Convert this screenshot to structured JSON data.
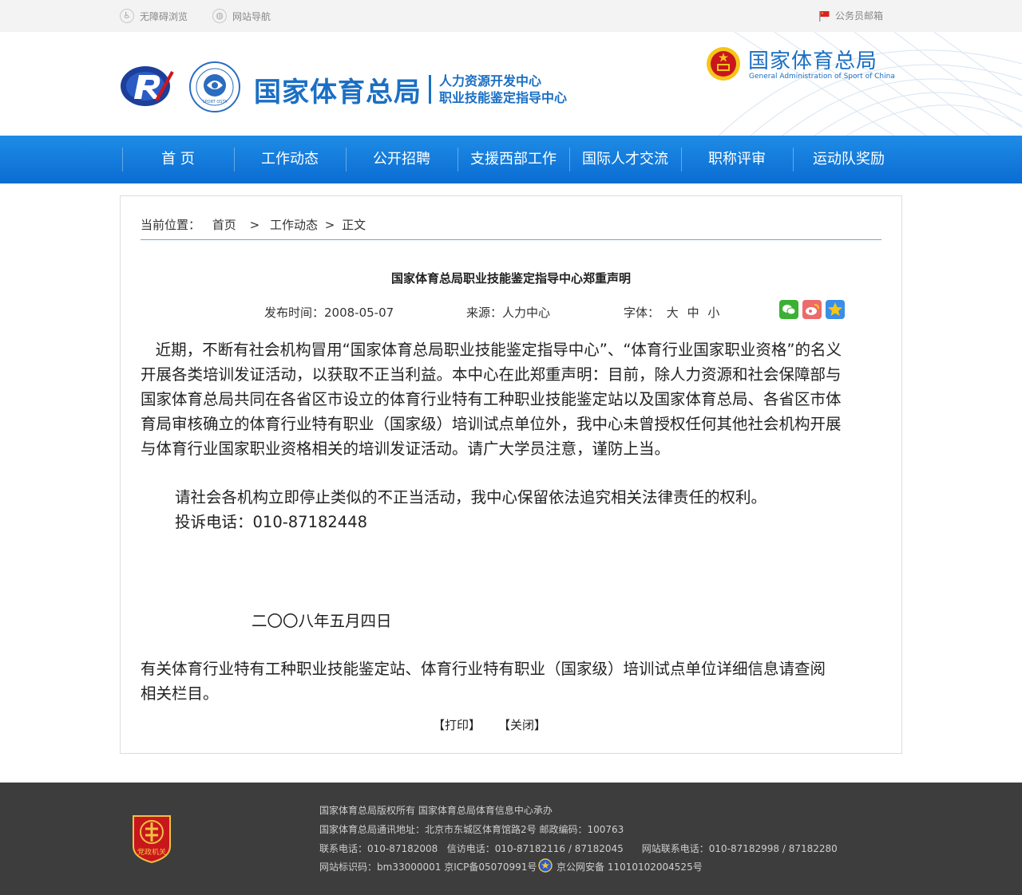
{
  "topbar": {
    "accessible": "无障碍浏览",
    "sitemap": "网站导航",
    "mail": "公务员邮箱"
  },
  "header": {
    "org_name": "国家体育总局",
    "dept_line1": "人力资源开发中心",
    "dept_line2": "职业技能鉴定指导中心",
    "right_name": "国家体育总局",
    "right_english": "General Administration of Sport of China",
    "seal_text": "SPORT OSTA"
  },
  "nav": [
    "首 页",
    "工作动态",
    "公开招聘",
    "支援西部工作",
    "国际人才交流",
    "职称评审",
    "运动队奖励"
  ],
  "breadcrumb": {
    "label": "当前位置：",
    "home": "首页",
    "sep1": ">",
    "section": "工作动态",
    "sep2": ">",
    "current": "正文"
  },
  "article": {
    "title": "国家体育总局职业技能鉴定指导中心郑重声明",
    "publish": "发布时间：2008-05-07",
    "source": "来源：人力中心",
    "font_label": "字体：",
    "font_sizes": [
      "大",
      "中",
      "小"
    ],
    "paragraph1": "   近期，不断有社会机构冒用“国家体育总局职业技能鉴定指导中心”、“体育行业国家职业资格”的名义开展各类培训发证活动，以获取不正当利益。本中心在此郑重声明：目前，除人力资源和社会保障部与国家体育总局共同在各省区市设立的体育行业特有工种职业技能鉴定站以及国家体育总局、各省区市体育局审核确立的体育行业特有职业（国家级）培训试点单位外，我中心未曾授权任何其他社会机构开展与体育行业国家职业资格相关的培训发证活动。请广大学员注意，谨防上当。",
    "paragraph2": "请社会各机构立即停止类似的不正当活动，我中心保留依法追究相关法律责任的权利。",
    "paragraph3": "投诉电话：010-87182448",
    "date": "二〇〇八年五月四日",
    "paragraph4": "有关体育行业特有工种职业技能鉴定站、体育行业特有职业（国家级）培训试点单位详细信息请查阅 相关栏目。",
    "print": "【打印】",
    "close": "【关闭】"
  },
  "footer": {
    "badge_text": "党政机关",
    "line1": "国家体育总局版权所有   国家体育总局体育信息中心承办",
    "line2": "国家体育总局通讯地址：北京市东城区体育馆路2号   邮政编码：100763",
    "line3": "联系电话：010-87182008   信访电话：010-87182116 / 87182045      网站联系电话：010-87182998 / 87182280",
    "line4a": "网站标识码：bm33000001 京ICP备05070991号",
    "line4b": "京公网安备 11010102004525号"
  },
  "colors": {
    "nav_blue": "#0a6cd2",
    "title_blue": "#1a6fc4",
    "footer_bg": "#3d3d3d",
    "emblem_red": "#c8161d",
    "gold": "#f5c518"
  }
}
